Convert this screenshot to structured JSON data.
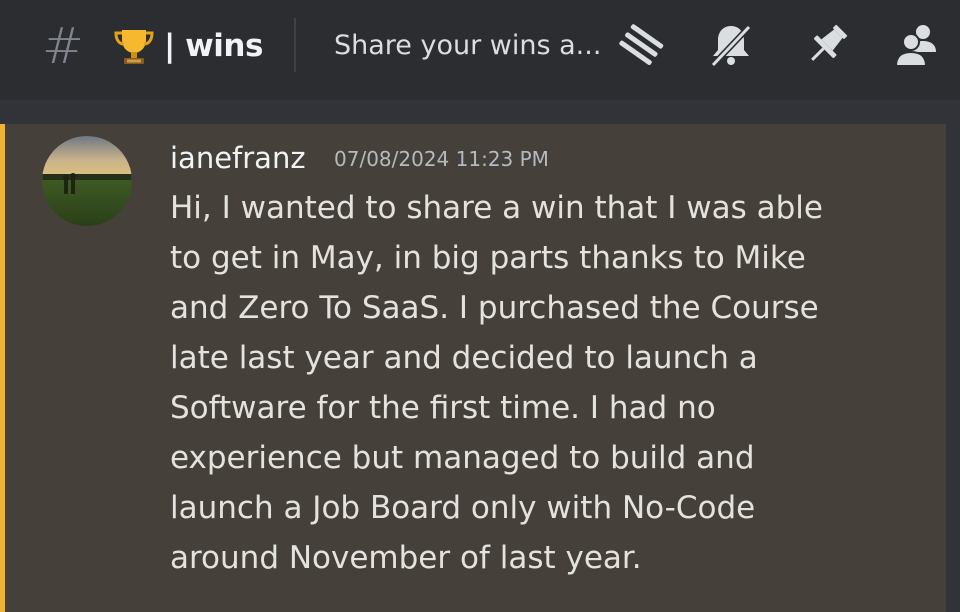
{
  "header": {
    "hash_symbol": "#",
    "channel_emoji": "trophy-icon",
    "channel_name": "| wins",
    "topic": "Share your wins a...",
    "icons": [
      "threads-icon",
      "notifications-muted-icon",
      "pin-icon",
      "member-list-icon"
    ]
  },
  "message": {
    "username": "ianefranz",
    "timestamp": "07/08/2024 11:23 PM",
    "lines": [
      "Hi, I wanted to share a win that I was able",
      "to get in May, in big parts thanks to Mike",
      "and Zero To SaaS. I purchased the Course",
      "late last year and decided to launch a",
      "Software for the first time. I had no",
      "experience but managed to build and",
      "launch a Job Board only with No-Code",
      "around November of last year."
    ]
  },
  "colors": {
    "header_bg": "#2b2d31",
    "message_highlight_bg": "#45403a",
    "mention_bar": "#f0b232",
    "text": "#e4e2de",
    "muted": "#b5bac1"
  }
}
